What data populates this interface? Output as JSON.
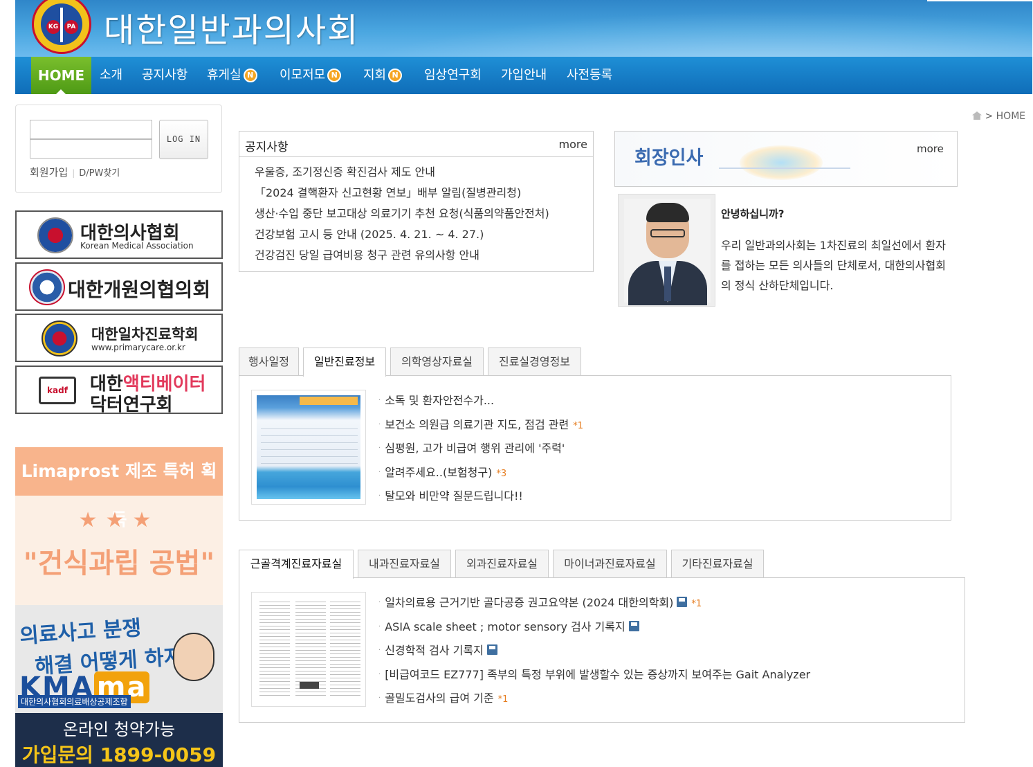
{
  "header": {
    "site_title": "대한일반과의사회",
    "logo_left": "KG",
    "logo_right": "PA"
  },
  "nav": {
    "home": "HOME",
    "items": [
      {
        "label": "소개",
        "badge": ""
      },
      {
        "label": "공지사항",
        "badge": ""
      },
      {
        "label": "휴게실",
        "badge": "N"
      },
      {
        "label": "이모저모",
        "badge": "N"
      },
      {
        "label": "지회",
        "badge": "N"
      },
      {
        "label": "임상연구회",
        "badge": ""
      },
      {
        "label": "가입안내",
        "badge": ""
      },
      {
        "label": "사전등록",
        "badge": ""
      }
    ]
  },
  "login": {
    "button": "LOG IN",
    "join": "회원가입",
    "find": "D/PW찾기"
  },
  "side_banners": [
    {
      "title": "대한의사협회",
      "sub": "Korean Medical Association"
    },
    {
      "title": "대한개원의협의회",
      "sub": ""
    },
    {
      "title": "대한일차진료학회",
      "sub": "www.primarycare.or.kr",
      "emblem": "KPCS"
    },
    {
      "title_a": "대한",
      "title_b": "액티베이터",
      "title_c": "닥터연구회",
      "emblem": "kadf"
    }
  ],
  "ads": {
    "ad1_top": "Limaprost 제조 특허 획득",
    "ad1_stars": "★★★",
    "ad1_main": "\"건식과립 공법\"",
    "ad2_line1": "의료사고 분쟁",
    "ad2_line2": "해결 어떻게 하지?",
    "ad2_brand_a": "KMA",
    "ad2_brand_b": "ma",
    "ad2_org": "대한의사협회의료배상공제조합",
    "ad2_b1": "온라인 청약가능",
    "ad2_b2": "가입문의 1899-0059"
  },
  "breadcrumb": {
    "label": "HOME",
    "sep": ">"
  },
  "notice": {
    "title": "공지사항",
    "more": "more",
    "items": [
      "우울증, 조기정신증 확진검사 제도 안내",
      "「2024 결핵환자 신고현황 연보」배부 알림(질병관리청)",
      "생산·수입 중단 보고대상 의료기기 추천 요청(식품의약품안전처)",
      "건강보험 고시 등 안내 (2025. 4. 21. ~ 4. 27.)",
      "건강검진 당일 급여비용 청구 관련 유의사항 안내"
    ]
  },
  "president": {
    "title": "회장인사",
    "more": "more",
    "greeting": "안녕하십니까?",
    "text": "우리 일반과의사회는 1차진료의 최일선에서 환자를 접하는 모든 의사들의 단체로서, 대한의사협회의 정식 산하단체입니다."
  },
  "tabs1": {
    "labels": [
      "행사일정",
      "일반진료정보",
      "의학영상자료실",
      "진료실경영정보"
    ],
    "active": 1,
    "posts": [
      {
        "title": "소독 및 환자안전수가...",
        "comments": ""
      },
      {
        "title": "보건소 의원급 의료기관 지도, 점검 관련",
        "comments": "*1"
      },
      {
        "title": "심평원, 고가 비급여 행위 관리에 '주력'",
        "comments": ""
      },
      {
        "title": "알려주세요..(보험청구)",
        "comments": "*3"
      },
      {
        "title": "탈모와 비만약 질문드립니다!!",
        "comments": ""
      }
    ]
  },
  "tabs2": {
    "labels": [
      "근골격계진료자료실",
      "내과진료자료실",
      "외과진료자료실",
      "마이너과진료자료실",
      "기타진료자료실"
    ],
    "active": 0,
    "posts": [
      {
        "title": "일차의료용 근거기반 골다공증 권고요약본 (2024 대한의학회)",
        "file": true,
        "comments": "*1"
      },
      {
        "title": "ASIA scale sheet ; motor sensory 검사 기록지",
        "file": true,
        "comments": ""
      },
      {
        "title": "신경학적 검사 기록지",
        "file": true,
        "comments": ""
      },
      {
        "title": "[비급여코드 EZ777] 족부의 특정 부위에 발생할수 있는 증상까지 보여주는 Gait Analyzer",
        "file": false,
        "comments": ""
      },
      {
        "title": "골밀도검사의 급여 기준",
        "file": false,
        "comments": "*1"
      }
    ]
  },
  "colors": {
    "header_blue": "#2f86c9",
    "nav_blue": "#0f6db8",
    "home_green": "#5aa51e",
    "badge_orange": "#f5a623",
    "comment_orange": "#e67e22"
  }
}
